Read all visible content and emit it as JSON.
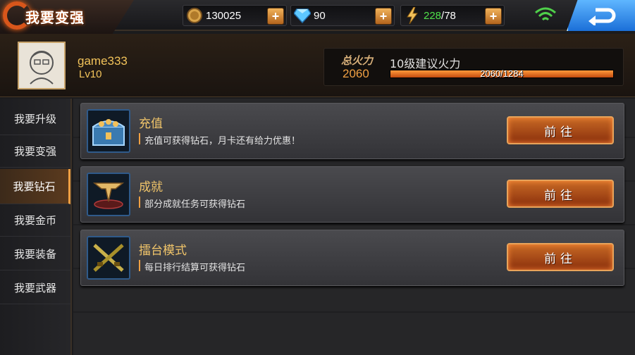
{
  "header": {
    "title": "我要变强",
    "gold": {
      "value": "130025",
      "icon": "gold-coin-icon"
    },
    "diamond": {
      "value": "90",
      "icon": "diamond-icon"
    },
    "energy": {
      "current": "228",
      "separator": "/",
      "max": "78",
      "icon": "lightning-icon"
    },
    "plus_label": "+",
    "wifi_icon": "wifi-icon",
    "back_icon": "back-arrow-icon"
  },
  "profile": {
    "username": "game333",
    "level": "Lv10",
    "power_label": "总火力",
    "power_value": "2060",
    "suggest_text": "10级建议火力",
    "power_progress_text": "2060/1284",
    "power_progress_fraction": 1.0
  },
  "sidebar": {
    "items": [
      {
        "label": "我要升级",
        "active": false
      },
      {
        "label": "我要变强",
        "active": false
      },
      {
        "label": "我要钻石",
        "active": true
      },
      {
        "label": "我要金币",
        "active": false
      },
      {
        "label": "我要装备",
        "active": false
      },
      {
        "label": "我要武器",
        "active": false
      }
    ]
  },
  "cards": [
    {
      "title": "充值",
      "desc": "充值可获得钻石，月卡还有给力优惠！",
      "button": "前往",
      "icon": "treasure-chest-icon"
    },
    {
      "title": "成就",
      "desc": "部分成就任务可获得钻石",
      "button": "前往",
      "icon": "achievement-emblem-icon"
    },
    {
      "title": "擂台模式",
      "desc": "每日排行结算可获得钻石",
      "button": "前往",
      "icon": "crossed-guns-icon"
    }
  ],
  "colors": {
    "accent_orange": "#f0a043",
    "gold_text": "#f2c35a",
    "energy_green": "#4fe04a",
    "back_blue": "#1b6fd8"
  }
}
